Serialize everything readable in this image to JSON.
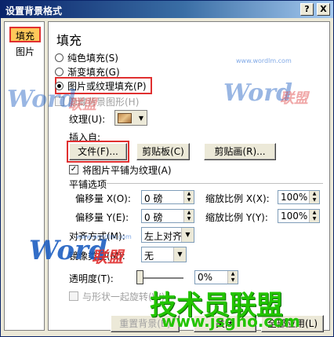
{
  "window": {
    "title": "设置背景格式",
    "help_label": "?",
    "close_label": "X"
  },
  "nav": {
    "items": [
      {
        "label": "填充"
      },
      {
        "label": "图片"
      }
    ]
  },
  "fill": {
    "heading": "填充",
    "options": [
      {
        "label": "纯色填充(S)",
        "selected": false
      },
      {
        "label": "渐变填充(G)",
        "selected": false
      },
      {
        "label": "图片或纹理填充(P)",
        "selected": true
      }
    ],
    "hide_bg_graphics": "隐藏背景图形(H)",
    "texture_label": "纹理(U):",
    "insert_from": "插入自:",
    "btn_file": "文件(F)...",
    "btn_clipboard": "剪贴板(C)",
    "btn_clipart": "剪贴画(R)...",
    "tile_label": "将图片平铺为纹理(A)",
    "tile_checked": true,
    "tile_options_title": "平铺选项",
    "offset_x_label": "偏移量 X(O):",
    "offset_x_value": "0 磅",
    "scale_x_label": "缩放比例 X(X):",
    "scale_x_value": "100%",
    "offset_y_label": "偏移量 Y(E):",
    "offset_y_value": "0 磅",
    "scale_y_label": "缩放比例 Y(Y):",
    "scale_y_value": "100%",
    "align_label": "对齐方式(M):",
    "align_value": "左上对齐",
    "mirror_label": "镜像类型(M):",
    "mirror_value": "无",
    "transparency_label": "透明度(T):",
    "transparency_value": "0%",
    "rotate_label": "与形状一起旋转(W)",
    "btn_reset": "重置背景(B)",
    "btn_close": "关闭",
    "btn_apply_all": "全部应用(L)"
  },
  "watermarks": {
    "word": "Word",
    "lianmeng": "联盟",
    "site": "www.wordlm.com",
    "brand": "技术员联盟",
    "brand_url": "www.jsgho.com"
  }
}
